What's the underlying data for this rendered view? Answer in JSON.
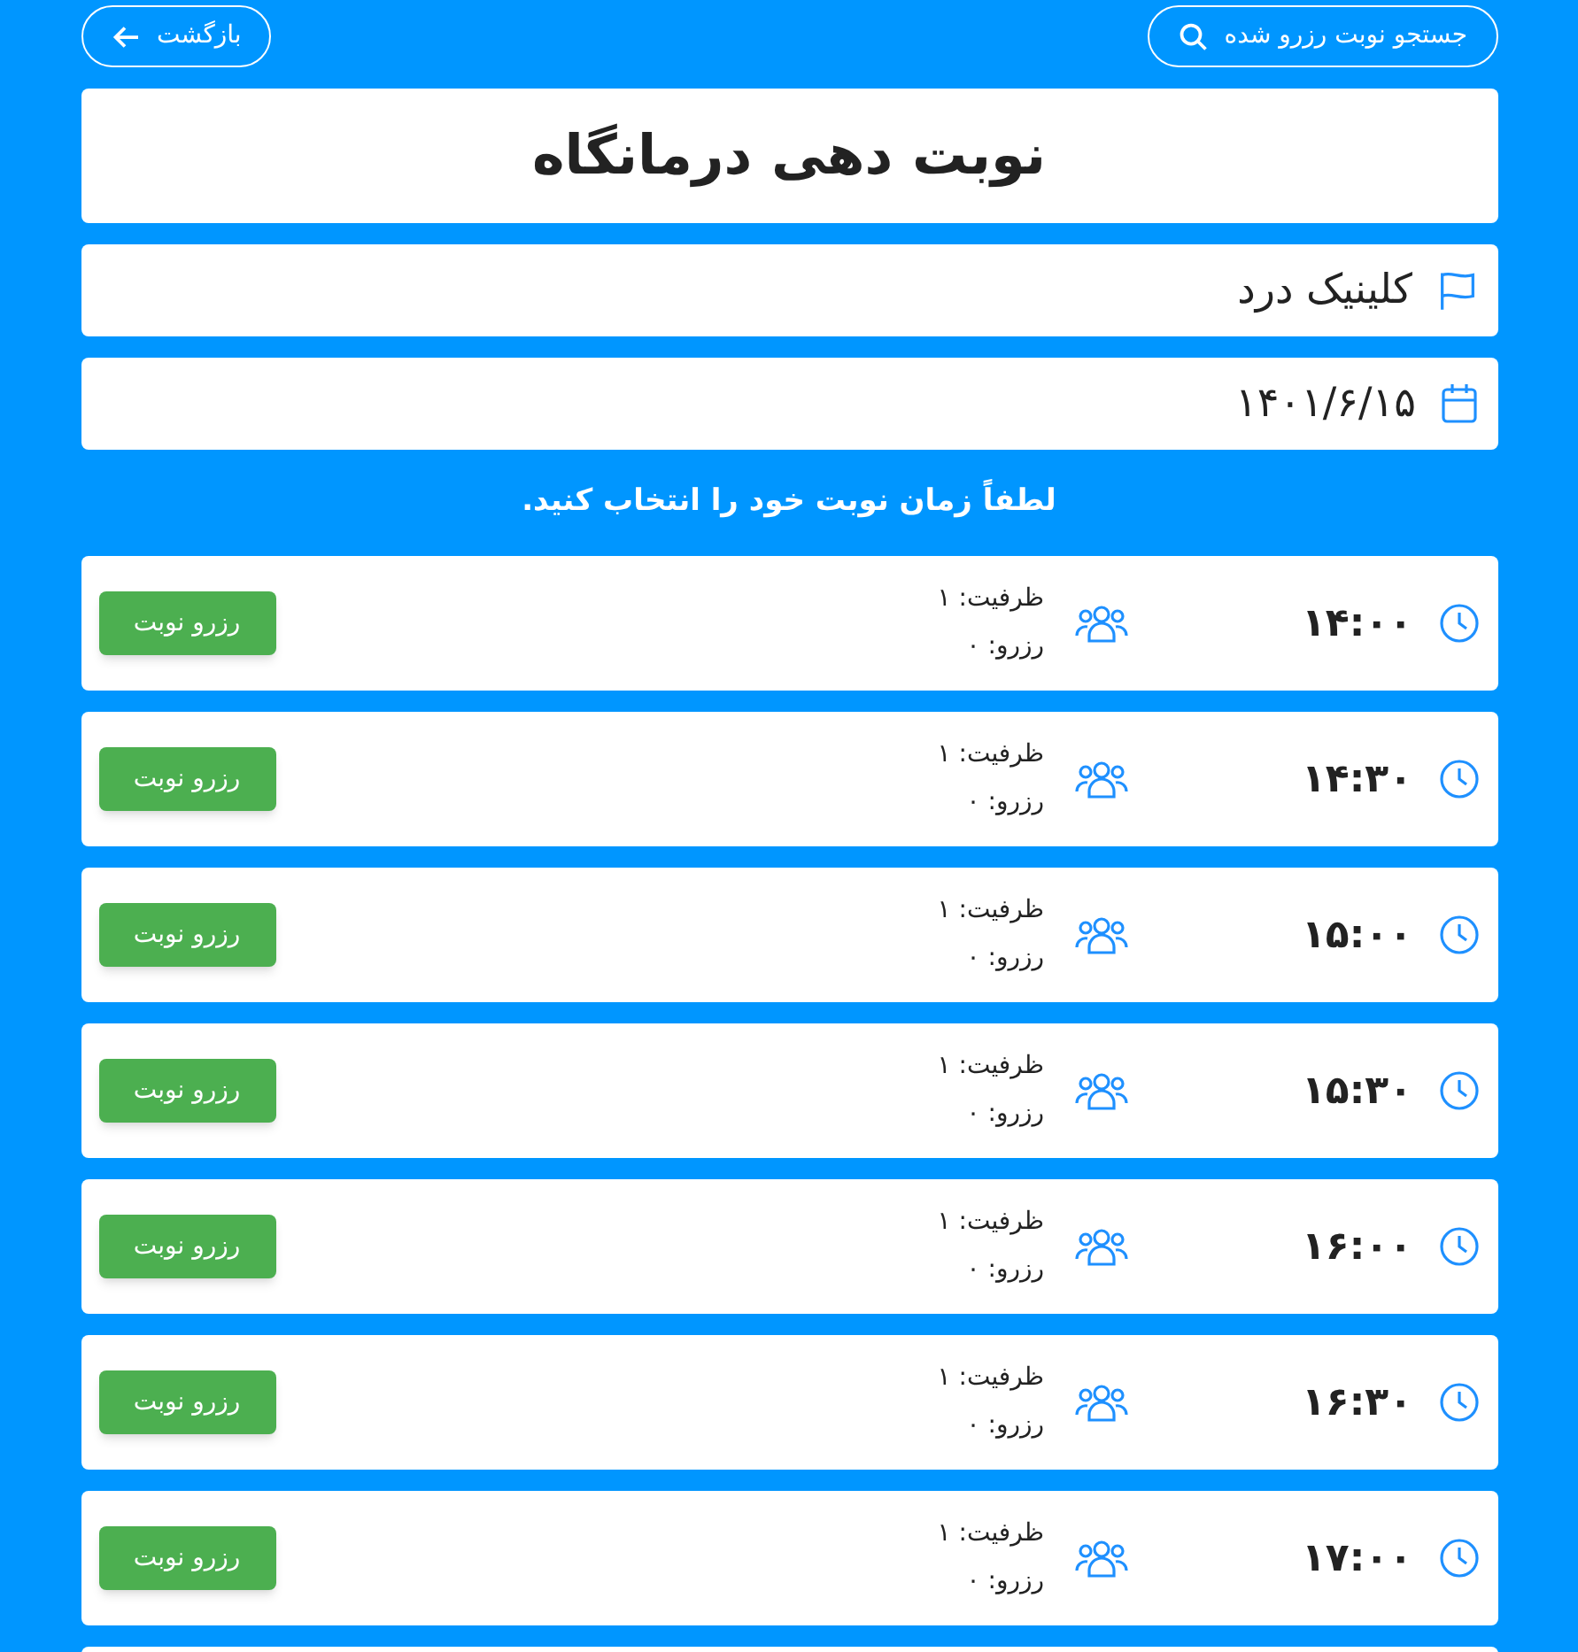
{
  "top_bar": {
    "search_button": "جستجو نوبت رزرو شده",
    "back_button": "بازگشت"
  },
  "title": "نوبت دهی درمانگاه",
  "clinic": "کلینیک درد",
  "date": "۱۴۰۱/۶/۱۵",
  "instruction": "لطفاً زمان نوبت خود را انتخاب کنید.",
  "slots": [
    {
      "time": "۱۴:۰۰",
      "capacity": "ظرفیت: ۱",
      "reserved": "رزرو: ۰",
      "button": "رزرو نوبت"
    },
    {
      "time": "۱۴:۳۰",
      "capacity": "ظرفیت: ۱",
      "reserved": "رزرو: ۰",
      "button": "رزرو نوبت"
    },
    {
      "time": "۱۵:۰۰",
      "capacity": "ظرفیت: ۱",
      "reserved": "رزرو: ۰",
      "button": "رزرو نوبت"
    },
    {
      "time": "۱۵:۳۰",
      "capacity": "ظرفیت: ۱",
      "reserved": "رزرو: ۰",
      "button": "رزرو نوبت"
    },
    {
      "time": "۱۶:۰۰",
      "capacity": "ظرفیت: ۱",
      "reserved": "رزرو: ۰",
      "button": "رزرو نوبت"
    },
    {
      "time": "۱۶:۳۰",
      "capacity": "ظرفیت: ۱",
      "reserved": "رزرو: ۰",
      "button": "رزرو نوبت"
    },
    {
      "time": "۱۷:۰۰",
      "capacity": "ظرفیت: ۱",
      "reserved": "رزرو: ۰",
      "button": "رزرو نوبت"
    }
  ]
}
